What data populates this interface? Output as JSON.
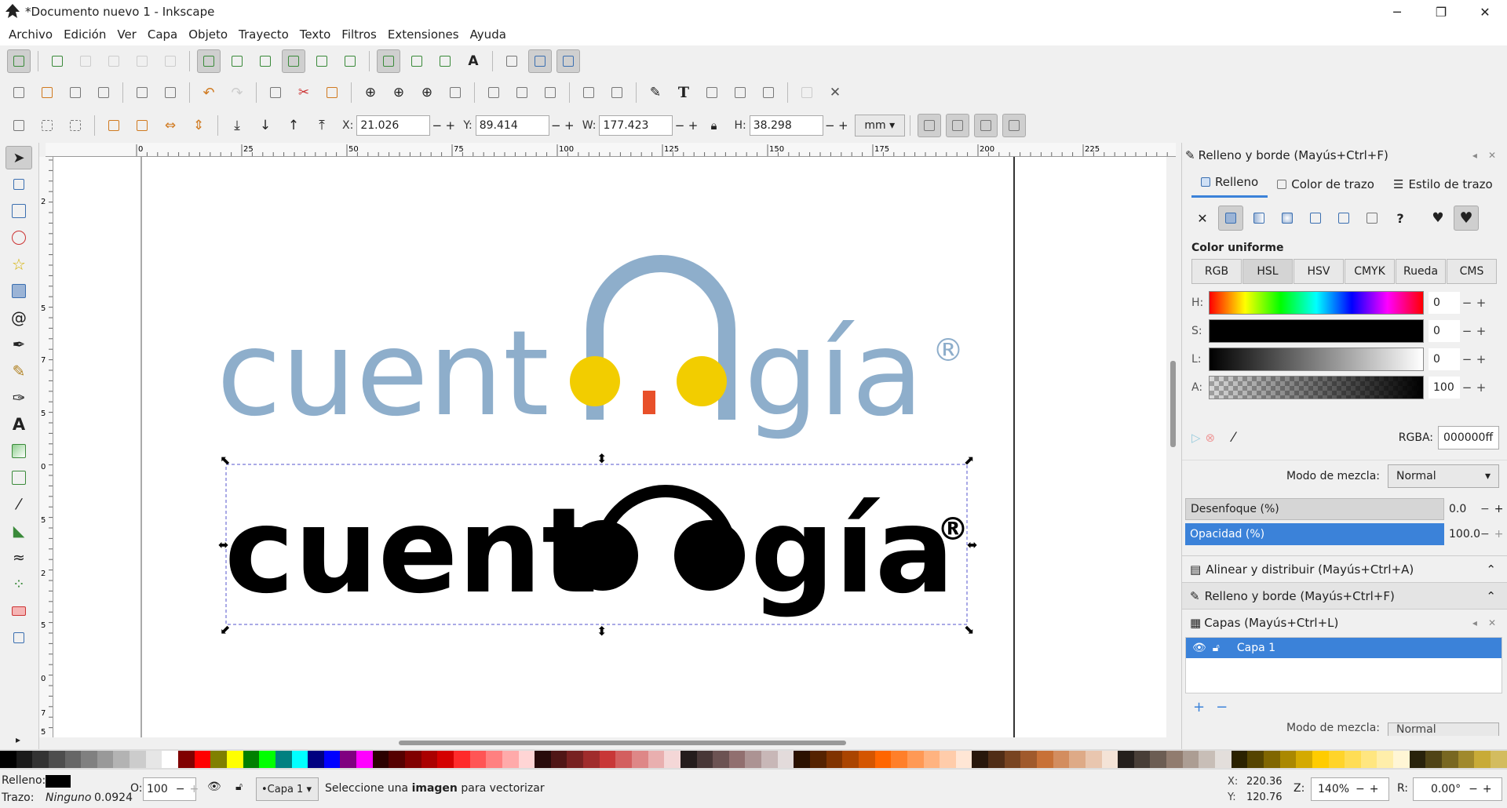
{
  "window": {
    "title": "*Documento nuevo 1 - Inkscape",
    "minimize": "─",
    "maximize": "❐",
    "close": "✕"
  },
  "menu": [
    "Archivo",
    "Edición",
    "Ver",
    "Capa",
    "Objeto",
    "Trayecto",
    "Texto",
    "Filtros",
    "Extensiones",
    "Ayuda"
  ],
  "coords": {
    "x_label": "X:",
    "x": "21.026",
    "y_label": "Y:",
    "y": "89.414",
    "w_label": "W:",
    "w": "177.423",
    "h_label": "H:",
    "h": "38.298",
    "unit": "mm"
  },
  "ruler_ticks": [
    "0",
    "25",
    "50",
    "75",
    "100",
    "125",
    "150",
    "175",
    "200",
    "225"
  ],
  "ruler_v_ticks": [
    "2",
    "5",
    "7",
    "5",
    "0",
    "5",
    "2",
    "5",
    "0",
    "7",
    "5"
  ],
  "canvas": {
    "logo_color_text_left": "cuent",
    "logo_color_text_right": "gía",
    "logo_black_text_left": "cuent",
    "logo_black_text_right": "gía",
    "registered": "®",
    "colors": {
      "blue": "#8eaecb",
      "yellow": "#f2cd00",
      "red": "#e8502a",
      "black": "#000000"
    }
  },
  "panel": {
    "title": "Relleno y borde (Mayús+Ctrl+F)",
    "tabs": [
      "Relleno",
      "Color de trazo",
      "Estilo de trazo"
    ],
    "section": "Color uniforme",
    "modes": [
      "RGB",
      "HSL",
      "HSV",
      "CMYK",
      "Rueda",
      "CMS"
    ],
    "sliders": [
      {
        "label": "H:",
        "value": "0"
      },
      {
        "label": "S:",
        "value": "0"
      },
      {
        "label": "L:",
        "value": "0"
      },
      {
        "label": "A:",
        "value": "100"
      }
    ],
    "rgba_label": "RGBA:",
    "rgba": "000000ff",
    "blend_label": "Modo de mezcla:",
    "blend": "Normal",
    "blur_label": "Desenfoque (%)",
    "blur": "0.0",
    "opacity_label": "Opacidad (%)",
    "opacity": "100.0",
    "dock_align": "Alinear y distribuir (Mayús+Ctrl+A)",
    "dock_fill": "Relleno y borde (Mayús+Ctrl+F)",
    "layers_title": "Capas (Mayús+Ctrl+L)",
    "layer_name": "Capa 1",
    "layers_blend_label": "Modo de mezcla:",
    "layers_blend": "Normal"
  },
  "status": {
    "fill_label": "Relleno:",
    "stroke_label": "Trazo:",
    "stroke_value": "Ninguno",
    "stroke_width": "0.0924",
    "opacity_label": "O:",
    "opacity": "100",
    "layer": "•Capa 1",
    "message_pre": "Seleccione una ",
    "message_bold": "imagen",
    "message_post": " para vectorizar",
    "cursor_x_label": "X:",
    "cursor_x": "220.36",
    "cursor_y_label": "Y:",
    "cursor_y": "120.76",
    "zoom_label": "Z:",
    "zoom": "140%",
    "rotate_label": "R:",
    "rotate": "0.00°"
  }
}
